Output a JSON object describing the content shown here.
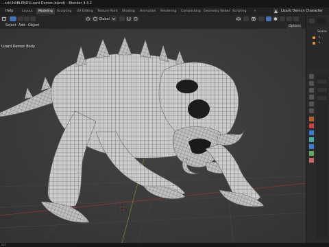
{
  "window": {
    "title": "...ork\\3d\\BLEND\\Lizard Demon.blend) - Blender 4.3.2"
  },
  "menu": {
    "help": "Help",
    "tabs": [
      "Layout",
      "Modeling",
      "Sculpting",
      "UV Editing",
      "Texture Paint",
      "Shading",
      "Animation",
      "Rendering",
      "Compositing",
      "Geometry Nodes",
      "Scripting"
    ],
    "active_tab": "Modeling",
    "add_tab": "+",
    "scene_name": "Lizard Demon Character"
  },
  "header": {
    "select": "Select",
    "add": "Add",
    "object": "Object",
    "orientation": "Global",
    "options": "Options"
  },
  "viewport": {
    "object_label": "Lizard Demon Body"
  },
  "outliner": {
    "items": [
      "Scene",
      "L",
      "L"
    ]
  },
  "status": {
    "text": "ect"
  },
  "colors": {
    "accent": "#4772b3",
    "bg": "#1d1d1d",
    "grid_x": "#8a3a3a",
    "grid_y": "#6f8a2a",
    "mesh": "#cfcfcf"
  }
}
